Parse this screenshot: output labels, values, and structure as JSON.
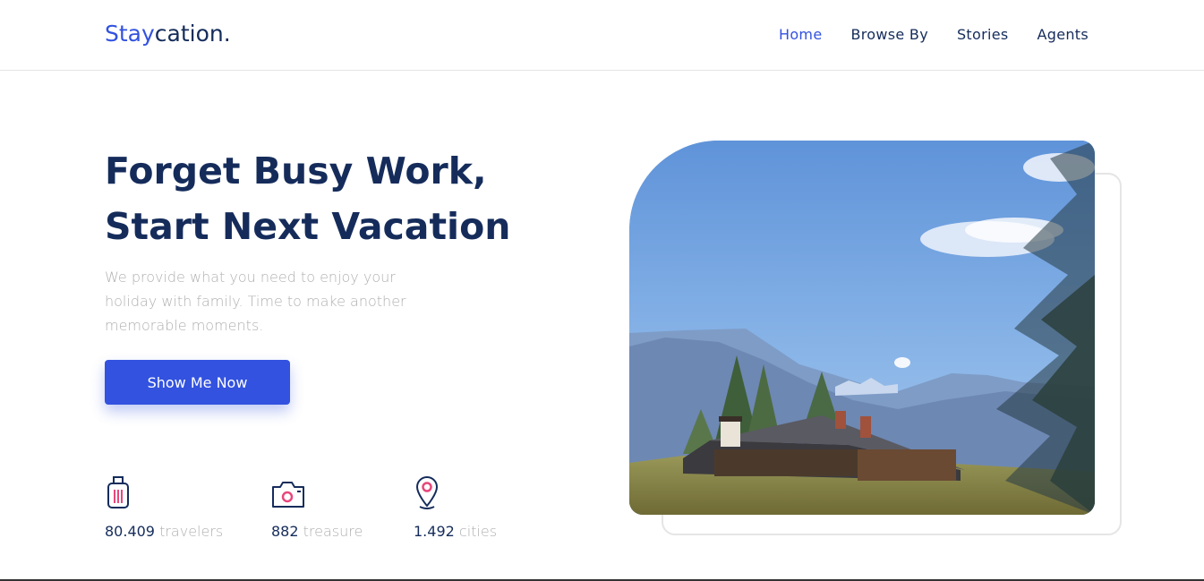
{
  "header": {
    "logo_part1": "Stay",
    "logo_part2": "cation.",
    "nav": [
      {
        "label": "Home",
        "active": true
      },
      {
        "label": "Browse By",
        "active": false
      },
      {
        "label": "Stories",
        "active": false
      },
      {
        "label": "Agents",
        "active": false
      }
    ]
  },
  "hero": {
    "title_line1": "Forget Busy Work,",
    "title_line2": "Start Next Vacation",
    "description": "We provide what you need to enjoy your holiday with family. Time to make another memorable moments.",
    "cta_label": "Show Me Now"
  },
  "stats": [
    {
      "icon": "suitcase-icon",
      "number": "80.409",
      "unit": "travelers"
    },
    {
      "icon": "camera-icon",
      "number": "882",
      "unit": "treasure"
    },
    {
      "icon": "map-pin-icon",
      "number": "1.492",
      "unit": "cities"
    }
  ],
  "colors": {
    "primary": "#3252df",
    "dark": "#152c5b",
    "muted": "#b0b0b0",
    "accent": "#e7487c"
  }
}
